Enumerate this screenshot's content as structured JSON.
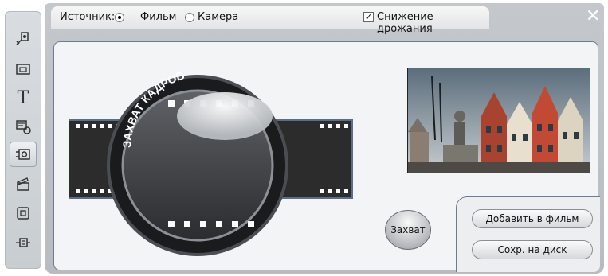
{
  "topbar": {
    "source_label": "Источник:",
    "film_label": "Фильм",
    "camera_label": "Камера",
    "stabilize_label": "Снижение дрожания",
    "source_selected": "Фильм",
    "stabilize_checked": true
  },
  "artwork": {
    "ring_text": "ЗАХВАТ КАДРОВ"
  },
  "buttons": {
    "capture": "Захват",
    "add_to_movie": "Добавить в фильм",
    "save_to_disk": "Сохр. на диск"
  },
  "sidebar": {
    "items": [
      {
        "icon": "video-effects-icon"
      },
      {
        "icon": "transition-icon"
      },
      {
        "icon": "title-icon"
      },
      {
        "icon": "subtitle-icon"
      },
      {
        "icon": "capture-frame-icon",
        "active": true
      },
      {
        "icon": "clapper-icon"
      },
      {
        "icon": "stop-motion-icon"
      },
      {
        "icon": "plugin-icon"
      }
    ]
  }
}
